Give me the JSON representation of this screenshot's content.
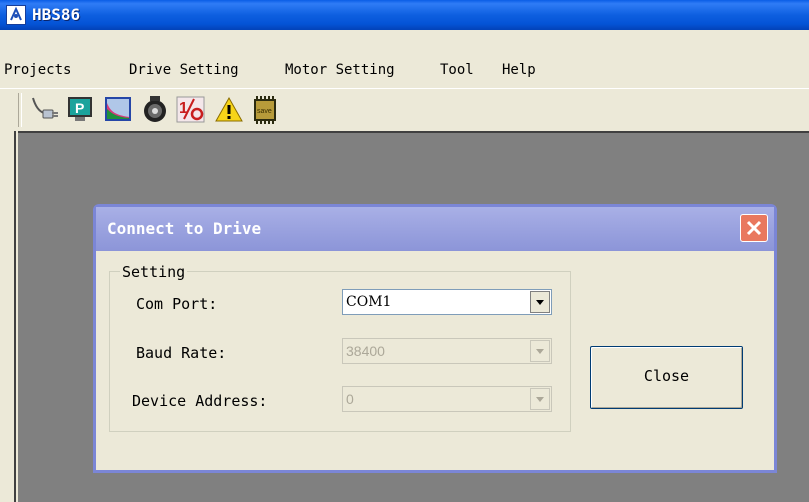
{
  "window": {
    "title": "HBS86"
  },
  "menu": [
    "Projects",
    "Drive Setting",
    "Motor Setting",
    "Tool",
    "Help"
  ],
  "toolbar": {
    "icons": [
      "connect-plug-icon",
      "parameter-p-icon",
      "chart-graph-icon",
      "motor-icon",
      "io-icon",
      "warning-icon",
      "save-chip-icon"
    ],
    "save_chip_label": "save",
    "io_label": "I/O"
  },
  "dialog": {
    "title": "Connect to Drive",
    "group_label": "Setting",
    "com_port_label": "Com Port:",
    "com_port_value": "COM1",
    "baud_rate_label": "Baud Rate:",
    "baud_rate_value": "38400",
    "device_address_label": "Device Address:",
    "device_address_value": "0",
    "close_label": "Close"
  },
  "colors": {
    "titlebar": "#0453d6",
    "dialog_title": "#9aa2df",
    "close_x": "#e9785f",
    "workspace": "#808080"
  }
}
